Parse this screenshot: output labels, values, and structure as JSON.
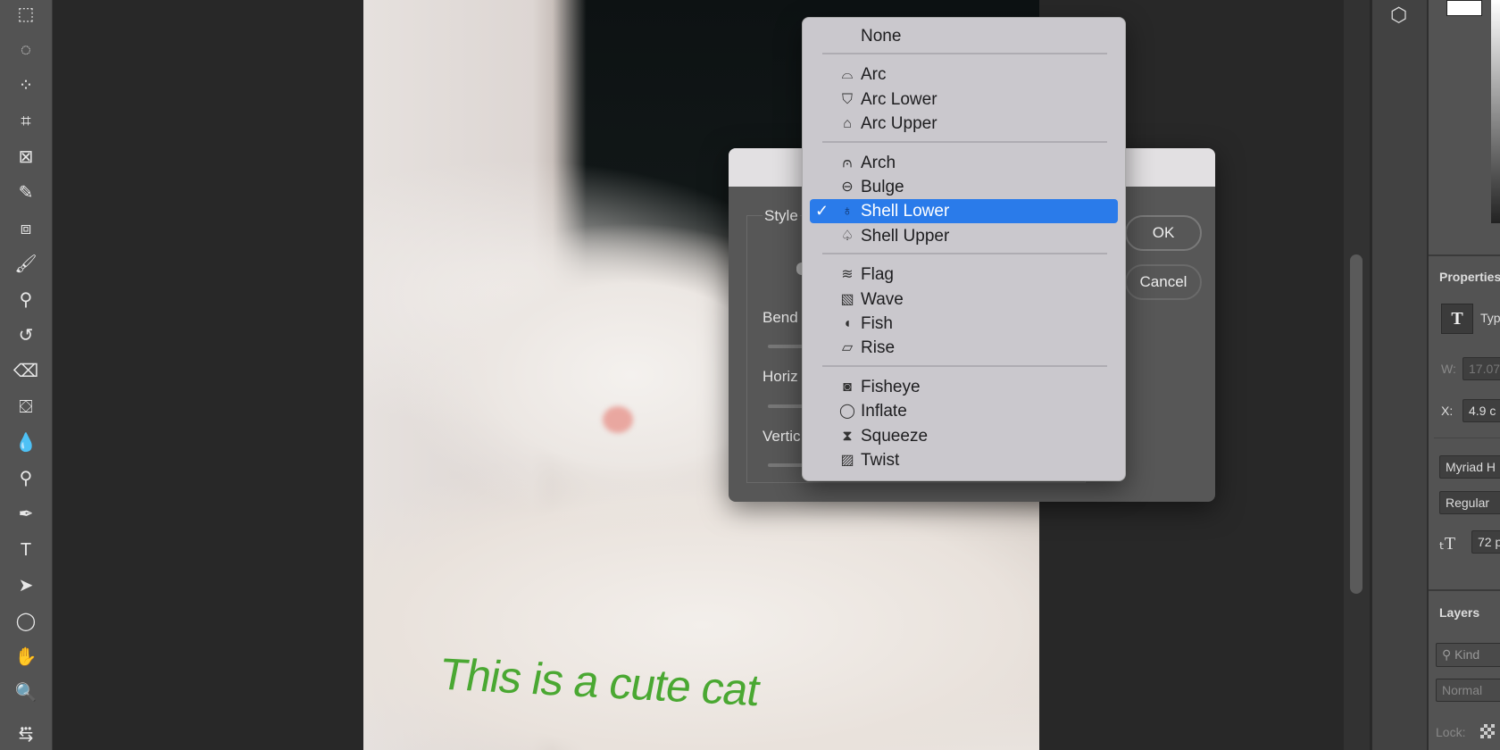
{
  "toolbar": {
    "tools": [
      {
        "name": "marquee-icon",
        "glyph": "⬚"
      },
      {
        "name": "lasso-icon",
        "glyph": "◌"
      },
      {
        "name": "quick-select-icon",
        "glyph": "⁘"
      },
      {
        "name": "crop-icon",
        "glyph": "⌗"
      },
      {
        "name": "frame-icon",
        "glyph": "⊠"
      },
      {
        "name": "eyedropper-icon",
        "glyph": "✎"
      },
      {
        "name": "healing-brush-icon",
        "glyph": "⧈"
      },
      {
        "name": "brush-icon",
        "glyph": "🖌"
      },
      {
        "name": "stamp-icon",
        "glyph": "⚲"
      },
      {
        "name": "history-brush-icon",
        "glyph": "↺"
      },
      {
        "name": "eraser-icon",
        "glyph": "⌫"
      },
      {
        "name": "paint-bucket-icon",
        "glyph": "⛋"
      },
      {
        "name": "blur-icon",
        "glyph": "💧"
      },
      {
        "name": "dodge-icon",
        "glyph": "⚲"
      },
      {
        "name": "pen-icon",
        "glyph": "✒"
      },
      {
        "name": "type-icon",
        "glyph": "T"
      },
      {
        "name": "path-select-icon",
        "glyph": "➤"
      },
      {
        "name": "ellipse-icon",
        "glyph": "◯"
      },
      {
        "name": "hand-icon",
        "glyph": "✋"
      },
      {
        "name": "zoom-icon",
        "glyph": "🔍"
      },
      {
        "name": "more-icon",
        "glyph": "•••"
      },
      {
        "name": "swap-colors-icon",
        "glyph": "⇆"
      }
    ]
  },
  "canvas": {
    "text": "This is a cute cat",
    "text_color": "#4aa832"
  },
  "dialog": {
    "style_label": "Style",
    "bend_label": "Bend",
    "horizontal_label": "Horiz",
    "vertical_label": "Vertic",
    "ok": "OK",
    "cancel": "Cancel"
  },
  "menu": {
    "selected": "Shell Lower",
    "accent": "#2a7bea",
    "groups": [
      [
        {
          "label": "None",
          "icon": ""
        }
      ],
      [
        {
          "label": "Arc",
          "icon": "⌓"
        },
        {
          "label": "Arc Lower",
          "icon": "⛉"
        },
        {
          "label": "Arc Upper",
          "icon": "⌂"
        }
      ],
      [
        {
          "label": "Arch",
          "icon": "⩀"
        },
        {
          "label": "Bulge",
          "icon": "⊖"
        },
        {
          "label": "Shell Lower",
          "icon": "♁",
          "checked": true
        },
        {
          "label": "Shell Upper",
          "icon": "♤"
        }
      ],
      [
        {
          "label": "Flag",
          "icon": "≋"
        },
        {
          "label": "Wave",
          "icon": "▧"
        },
        {
          "label": "Fish",
          "icon": "◖"
        },
        {
          "label": "Rise",
          "icon": "▱"
        }
      ],
      [
        {
          "label": "Fisheye",
          "icon": "◙"
        },
        {
          "label": "Inflate",
          "icon": "◯"
        },
        {
          "label": "Squeeze",
          "icon": "⧗"
        },
        {
          "label": "Twist",
          "icon": "▨"
        }
      ]
    ]
  },
  "panel": {
    "properties_title": "Properties",
    "type_label": "Typ",
    "w_label": "W:",
    "w_value": "17.07",
    "x_label": "X:",
    "x_value": "4.9 c",
    "font_family": "Myriad H",
    "font_style": "Regular",
    "font_size": "72 p",
    "layers_title": "Layers",
    "kind_placeholder": "Kind",
    "blend_mode": "Normal",
    "lock_label": "Lock:"
  }
}
